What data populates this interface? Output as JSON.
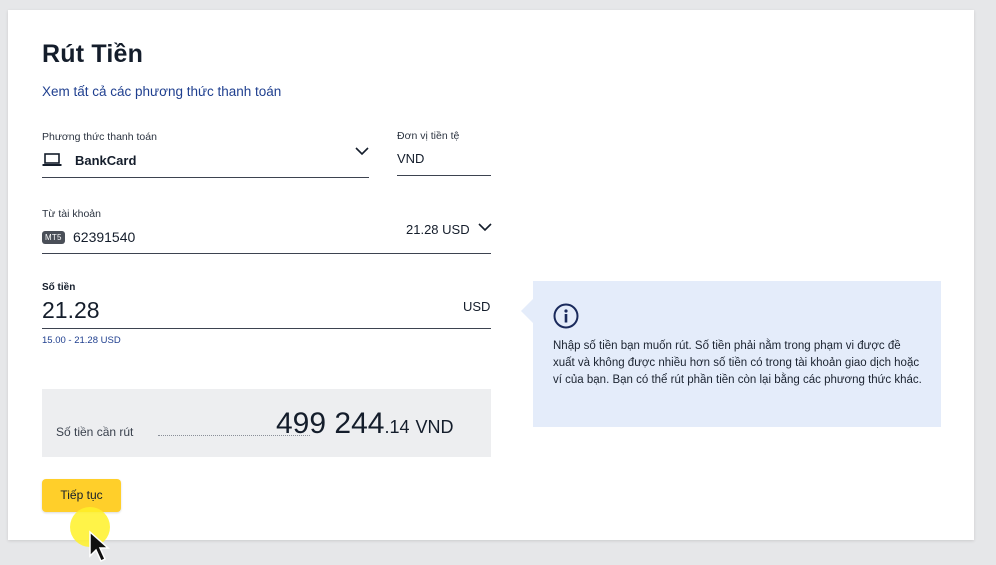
{
  "page": {
    "title": "Rút Tiền",
    "link": "Xem tất cả các phương thức thanh toán"
  },
  "payment_method": {
    "label": "Phương thức thanh toán",
    "value": "BankCard",
    "icon": "laptop-icon"
  },
  "currency": {
    "label": "Đơn vị tiền tệ",
    "value": "VND"
  },
  "from_account": {
    "label": "Từ tài khoản",
    "badge": "MT5",
    "number": "62391540",
    "balance": "21.28 USD"
  },
  "amount": {
    "label": "Số tiền",
    "value": "21.28",
    "currency": "USD",
    "range": "15.00 - 21.28 USD"
  },
  "summary": {
    "label": "Số tiền cần rút",
    "amount_int": "499 244",
    "amount_dec": ".14",
    "currency": "VND"
  },
  "info": {
    "text": "Nhập số tiền bạn muốn rút. Số tiền phải nằm trong phạm vi được đề xuất và không được nhiều hơn số tiền có trong tài khoản giao dịch hoặc ví của bạn. Bạn có thể rút phần tiền còn lại bằng các phương thức khác.",
    "icon": "info-icon"
  },
  "continue_button": "Tiếp tục",
  "colors": {
    "accent_yellow": "#ffcf2a",
    "link_blue": "#1f3f8f",
    "info_bg": "#e4ecfa"
  }
}
